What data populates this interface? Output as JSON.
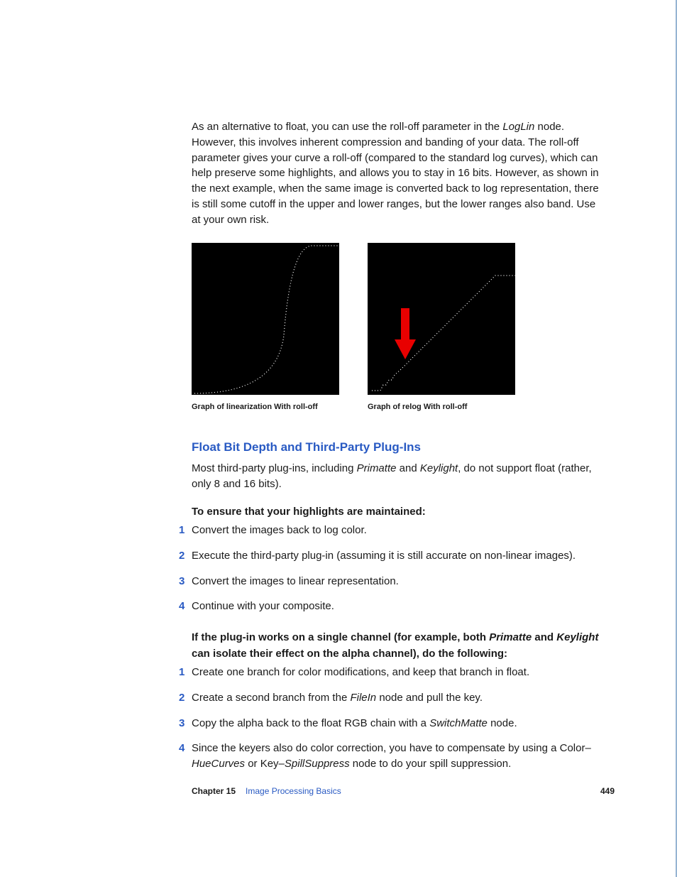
{
  "para1_a": "As an alternative to float, you can use the roll-off parameter in the ",
  "para1_loglin": "LogLin",
  "para1_b": " node. However, this involves inherent compression and banding of your data. The roll-off parameter gives your curve a roll-off (compared to the standard log curves), which can help preserve some highlights, and allows you to stay in 16 bits. However, as shown in the next example, when the same image is converted back to log representation, there is still some cutoff in the upper and lower ranges, but the lower ranges also band. Use at your own risk.",
  "caption1": "Graph of linearization With roll-off",
  "caption2": "Graph of relog With roll-off",
  "heading": "Float Bit Depth and Third-Party Plug-Ins",
  "para2_a": "Most third-party plug-ins, including ",
  "para2_primatte": "Primatte",
  "para2_b": " and ",
  "para2_keylight": "Keylight",
  "para2_c": ", do not support float (rather, only 8 and 16 bits).",
  "lead1": "To ensure that your highlights are maintained:",
  "list1": [
    "Convert the images back to log color.",
    "Execute the third-party plug-in (assuming it is still accurate on non-linear images).",
    "Convert the images to linear representation.",
    "Continue with your composite."
  ],
  "lead2_a": "If the plug-in works on a single channel (for example, both ",
  "lead2_primatte": "Primatte",
  "lead2_b": " and ",
  "lead2_keylight": "Keylight",
  "lead2_c": " can isolate their effect on the alpha channel), do the following:",
  "l2_1": "Create one branch for color modifications, and keep that branch in float.",
  "l2_2a": "Create a second branch from the ",
  "l2_2_filein": "FileIn",
  "l2_2b": " node and pull the key.",
  "l2_3a": "Copy the alpha back to the float RGB chain with a ",
  "l2_3_switchmatte": "SwitchMatte",
  "l2_3b": " node.",
  "l2_4a": "Since the keyers also do color correction, you have to compensate by using a Color–",
  "l2_4_huecurves": "HueCurves",
  "l2_4b": " or Key–",
  "l2_4_spillsuppress": "SpillSuppress",
  "l2_4c": " node to do your spill suppression.",
  "chapter": "Chapter 15",
  "chapter_title": "Image Processing Basics",
  "page_number": "449"
}
